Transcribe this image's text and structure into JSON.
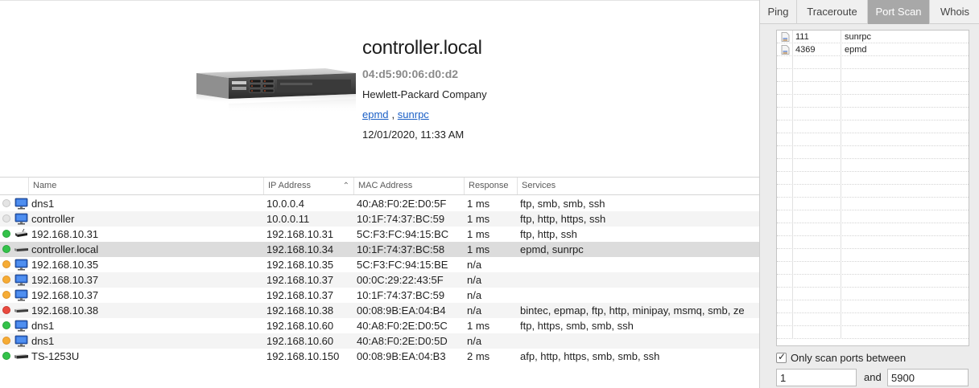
{
  "detail": {
    "hostname": "controller.local",
    "mac": "04:d5:90:06:d0:d2",
    "vendor": "Hewlett-Packard Company",
    "services": [
      "epmd",
      "sunrpc"
    ],
    "services_sep": ",",
    "timestamp": "12/01/2020, 11:33 AM",
    "image": "rack-server-image"
  },
  "table": {
    "columns": [
      "Name",
      "IP Address",
      "MAC Address",
      "Response",
      "Services"
    ],
    "sort_column": "IP Address",
    "rows": [
      {
        "status": "gray",
        "icon": "monitor-icon",
        "name": "dns1",
        "ip": "10.0.0.4",
        "mac": "40:A8:F0:2E:D0:5F",
        "response": "1 ms",
        "services": "ftp, smb, smb, ssh"
      },
      {
        "status": "gray",
        "icon": "monitor-icon",
        "name": "controller",
        "ip": "10.0.0.11",
        "mac": "10:1F:74:37:BC:59",
        "response": "1 ms",
        "services": "ftp, http, https, ssh"
      },
      {
        "status": "green",
        "icon": "router-icon",
        "name": "192.168.10.31",
        "ip": "192.168.10.31",
        "mac": "5C:F3:FC:94:15:BC",
        "response": "1 ms",
        "services": "ftp, http, ssh"
      },
      {
        "status": "green",
        "icon": "server-icon",
        "name": "controller.local",
        "ip": "192.168.10.34",
        "mac": "10:1F:74:37:BC:58",
        "response": "1 ms",
        "services": "epmd, sunrpc",
        "selected": true
      },
      {
        "status": "orange",
        "icon": "monitor-icon",
        "name": "192.168.10.35",
        "ip": "192.168.10.35",
        "mac": "5C:F3:FC:94:15:BE",
        "response": "n/a",
        "services": ""
      },
      {
        "status": "orange",
        "icon": "monitor-icon",
        "name": "192.168.10.37",
        "ip": "192.168.10.37",
        "mac": "00:0C:29:22:43:5F",
        "response": "n/a",
        "services": ""
      },
      {
        "status": "orange",
        "icon": "monitor-icon",
        "name": "192.168.10.37",
        "ip": "192.168.10.37",
        "mac": "10:1F:74:37:BC:59",
        "response": "n/a",
        "services": ""
      },
      {
        "status": "red",
        "icon": "server-icon",
        "name": "192.168.10.38",
        "ip": "192.168.10.38",
        "mac": "00:08:9B:EA:04:B4",
        "response": "n/a",
        "services": "bintec, epmap, ftp, http, minipay, msmq, smb, ze"
      },
      {
        "status": "green",
        "icon": "monitor-icon",
        "name": "dns1",
        "ip": "192.168.10.60",
        "mac": "40:A8:F0:2E:D0:5C",
        "response": "1 ms",
        "services": "ftp, https, smb, smb, ssh"
      },
      {
        "status": "orange",
        "icon": "monitor-icon",
        "name": "dns1",
        "ip": "192.168.10.60",
        "mac": "40:A8:F0:2E:D0:5D",
        "response": "n/a",
        "services": ""
      },
      {
        "status": "green",
        "icon": "nas-icon",
        "name": "TS-1253U",
        "ip": "192.168.10.150",
        "mac": "00:08:9B:EA:04:B3",
        "response": "2 ms",
        "services": "afp, http, https, smb, smb, ssh"
      }
    ]
  },
  "tabs": [
    {
      "label": "Ping",
      "active": false
    },
    {
      "label": "Traceroute",
      "active": false
    },
    {
      "label": "Port Scan",
      "active": true
    },
    {
      "label": "Whois",
      "active": false
    }
  ],
  "port_scan": {
    "results": [
      {
        "port": "111",
        "service": "sunrpc"
      },
      {
        "port": "4369",
        "service": "epmd"
      }
    ],
    "only_scan_label": "Only scan ports between",
    "only_scan_checked": true,
    "from_port": "1",
    "and_label": "and",
    "to_port": "5900"
  },
  "colors": {
    "status_green": "#33c24a",
    "status_orange": "#f6ac35",
    "status_red": "#e94a3f",
    "status_gray": "#e4e4e4",
    "link": "#1a5fc6",
    "selected_row": "#dcdcdc",
    "active_tab": "#a8a8a8"
  }
}
